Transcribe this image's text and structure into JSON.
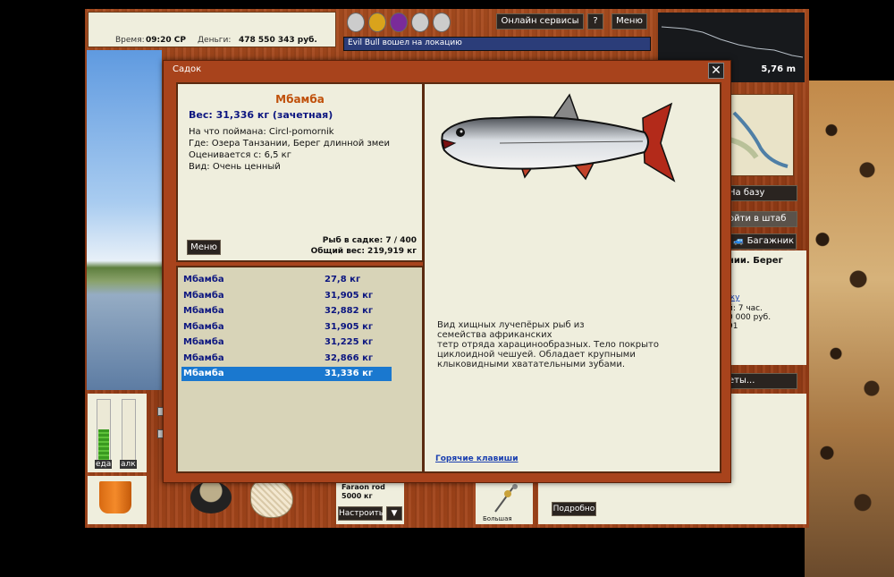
{
  "status": {
    "time_label": "Время:",
    "time_value": "09:20 СР",
    "money_label": "Деньги:",
    "money_value": "478 550 343 руб."
  },
  "topbar": {
    "online_button": "Онлайн сервисы",
    "help_button": "?",
    "menu_button": "Меню",
    "chat_message": "Evil Bull вошел на локацию",
    "depth_value": "5,76 m"
  },
  "right_panel": {
    "to_base_button": "На базу",
    "hq_button": "ойти в штаб",
    "trunk_button": "Багажник",
    "location_text": "нии. Берег",
    "link_text": "жу",
    "time_text": "й: 7 час.",
    "price_text": "0 000 руб.",
    "num_text": "91",
    "more_button": "еты..."
  },
  "left_panel": {
    "food_label": "еда",
    "alc_label": "алк",
    "food_level": 0.55,
    "alc_level": 0.0
  },
  "bottom": {
    "rod_name": "Faraon rod",
    "rod_weight": "5000 кг",
    "configure_button": "Настроить",
    "dropdown_button": "▼",
    "lure_label": "Большая",
    "details_button": "Подробно"
  },
  "dialog": {
    "title": "Садок",
    "close_icon": "✕",
    "fish_name": "Мбамба",
    "weight_line": "Вес: 31,336 кг (зачетная)",
    "caught_on": "На что поймана: Circl-pomornik",
    "where": "Где: Озера Танзании, Берег длинной змеи",
    "valued_from": "Оценивается с: 6,5 кг",
    "kind": "Вид: Очень ценный",
    "menu_button": "Меню",
    "fish_count": "Рыб в садке: 7 / 400",
    "total_weight": "Общий вес: 219,919 кг",
    "description_lines": [
      "Вид хищных лучепёрых рыб из",
      "семейства африканских",
      "тетр отряда харацинообразных. Тело покрыто",
      "циклоидной чешуей. Обладает крупными",
      "клыковидными хватательными зубами."
    ],
    "hotkeys_link": "Горячие клавиши",
    "fish_list": [
      {
        "name": "Мбамба",
        "weight": "27,8 кг"
      },
      {
        "name": "Мбамба",
        "weight": "31,905 кг"
      },
      {
        "name": "Мбамба",
        "weight": "32,882 кг"
      },
      {
        "name": "Мбамба",
        "weight": "31,905 кг"
      },
      {
        "name": "Мбамба",
        "weight": "31,225 кг"
      },
      {
        "name": "Мбамба",
        "weight": "32,866 кг"
      },
      {
        "name": "Мбамба",
        "weight": "31,336 кг"
      }
    ],
    "selected_index": 6
  },
  "colors": {
    "fish_name": "#c0500a",
    "weight_line": "#0c1680",
    "selection": "#1a78cf",
    "wood": "#9c3f17",
    "panel": "#efeedd"
  }
}
